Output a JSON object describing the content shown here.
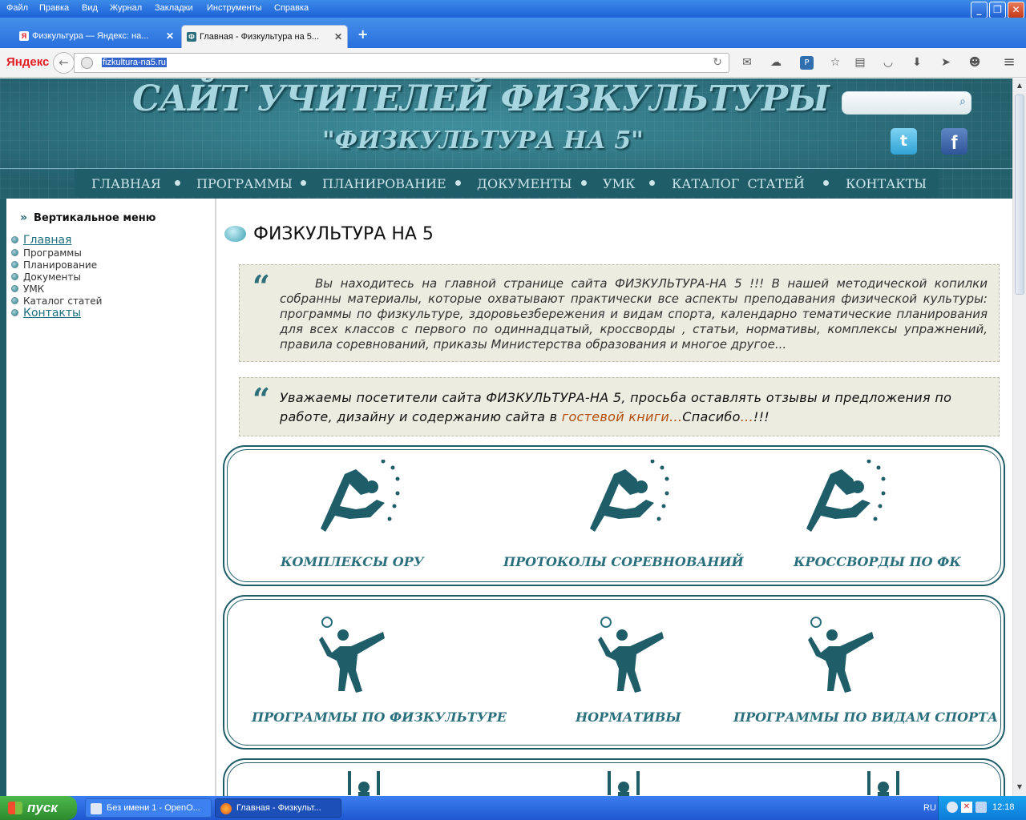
{
  "menubar": {
    "items": [
      "Файл",
      "Правка",
      "Вид",
      "Журнал",
      "Закладки",
      "Инструменты",
      "Справка"
    ]
  },
  "tabs": [
    {
      "title": "Физкультура — Яндекс: на...",
      "favicon": "yandex-icon",
      "active": false
    },
    {
      "title": "Главная - Физкультура на 5...",
      "favicon": "site-icon",
      "active": true
    }
  ],
  "navbar": {
    "logo": "Яндекс",
    "url": "fizkultura-na5.ru"
  },
  "site": {
    "title": "САЙТ УЧИТЕЛЕЙ ФИЗКУЛЬТУРЫ",
    "subtitle": "\"ФИЗКУЛЬТУРА НА 5\"",
    "search_value": "",
    "twitter_glyph": "t",
    "facebook_glyph": "f",
    "nav": [
      "ГЛАВНАЯ",
      "ПРОГРАММЫ",
      "ПЛАНИРОВАНИЕ",
      "ДОКУМЕНТЫ",
      "УМК",
      "КАТАЛОГ  СТАТЕЙ",
      "КОНТАКТЫ"
    ]
  },
  "sidebar": {
    "title": "Вертикальное меню",
    "items": [
      {
        "label": "Главная",
        "link": true
      },
      {
        "label": "Программы",
        "link": false
      },
      {
        "label": "Планирование",
        "link": false
      },
      {
        "label": "Документы",
        "link": false
      },
      {
        "label": "УМК",
        "link": false
      },
      {
        "label": "Каталог статей",
        "link": false
      },
      {
        "label": "Контакты",
        "link": true
      }
    ]
  },
  "main": {
    "title": "ФИЗКУЛЬТУРА НА 5",
    "quote_mark": "“",
    "intro": "Вы находитесь на главной странице сайта ФИЗКУЛЬТУРА-НА 5 !!! В нашей методической копилки собранны материалы, которые охватывают практически все аспекты преподавания физической культуры: программы по физкультуре, здоровьезбережения и видам спорта, календарно тематические планирования для всех классов с первого по одиннадцатый, кроссворды , статьи, нормативы, комплексы упражнений, правила соревнований, приказы Министерства образования и многое другое...",
    "notice_part1": "Уважаемы посетители сайта ФИЗКУЛЬТУРА-НА 5, просьба оставлять отзывы и предложения по работе, дизайну и содержанию сайта в ",
    "notice_link": "гостевой книги",
    "notice_part2": "...Спасибо...!!!",
    "cards_row1": [
      "КОМПЛЕКСЫ ОРУ",
      "ПРОТОКОЛЫ СОРЕВНОВАНИЙ",
      "КРОССВОРДЫ ПО ФК"
    ],
    "cards_row2": [
      "ПРОГРАММЫ ПО ФИЗКУЛЬТУРЕ",
      "НОРМАТИВЫ",
      "ПРОГРАММЫ ПО ВИДАМ СПОРТА"
    ]
  },
  "taskbar": {
    "start": "пуск",
    "tasks": [
      "Без имени 1 - OpenO...",
      "Главная - Физкульт..."
    ],
    "lang": "RU",
    "clock": "12:18"
  },
  "colors": {
    "accent": "#1f5d69",
    "header": "#2a6f7d",
    "link": "#b34d0a"
  }
}
